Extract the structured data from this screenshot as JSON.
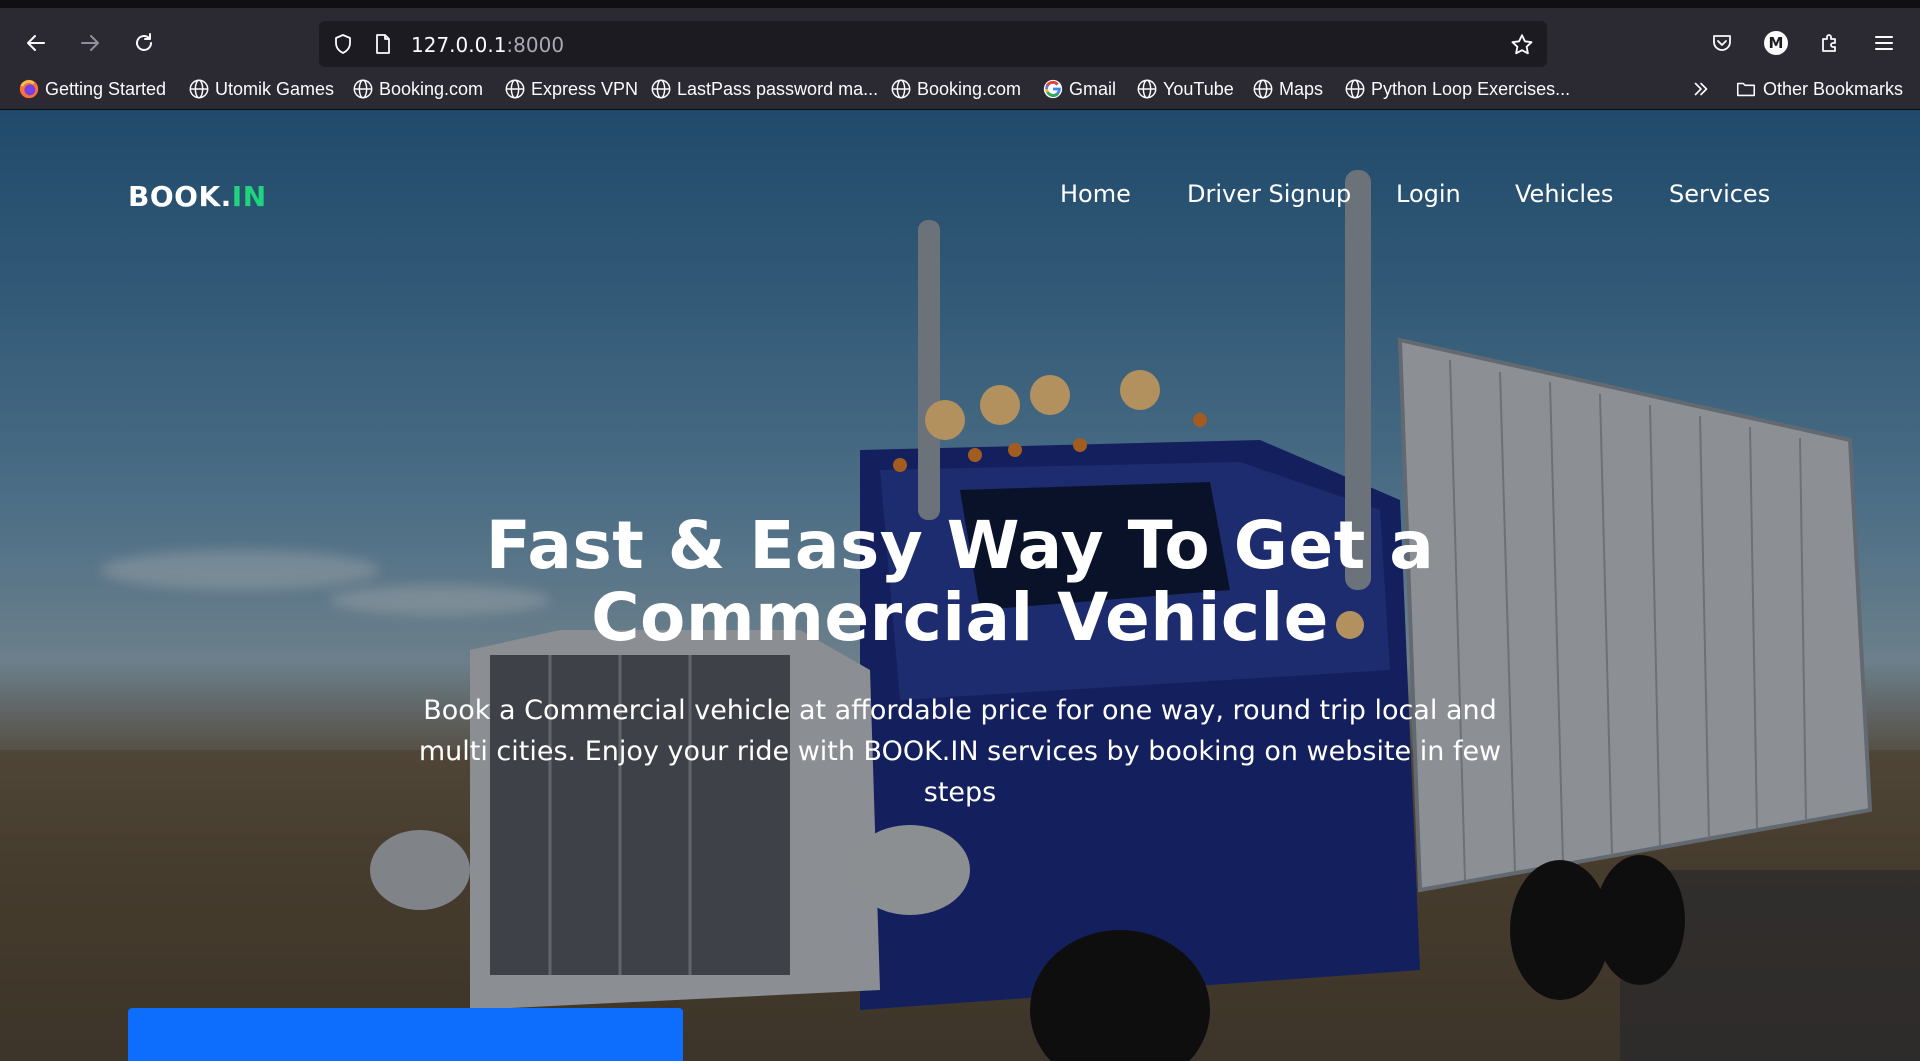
{
  "browser": {
    "url_host": "127.0.0.1",
    "url_port": ":8000",
    "profile_initial": "M",
    "icons": {
      "back": "arrow-left-icon",
      "forward": "arrow-right-icon",
      "reload": "reload-icon",
      "shield": "shield-icon",
      "page": "page-icon",
      "star": "star-icon",
      "pocket": "pocket-icon",
      "extensions": "puzzle-icon",
      "menu": "hamburger-icon"
    }
  },
  "bookmarks": {
    "items": [
      {
        "label": "Getting Started",
        "icon": "firefox-icon"
      },
      {
        "label": "Utomik Games",
        "icon": "globe-icon"
      },
      {
        "label": "Booking.com",
        "icon": "globe-icon"
      },
      {
        "label": "Express VPN",
        "icon": "globe-icon"
      },
      {
        "label": "LastPass password ma...",
        "icon": "globe-icon"
      },
      {
        "label": "Booking.com",
        "icon": "globe-icon"
      },
      {
        "label": "Gmail",
        "icon": "google-icon"
      },
      {
        "label": "YouTube",
        "icon": "globe-icon"
      },
      {
        "label": "Maps",
        "icon": "globe-icon"
      },
      {
        "label": "Python Loop Exercises...",
        "icon": "globe-icon"
      }
    ],
    "other_label": "Other Bookmarks"
  },
  "site": {
    "logo_main": "BOOK.",
    "logo_accent": "IN",
    "nav": [
      "Home",
      "Driver Signup",
      "Login",
      "Vehicles",
      "Services"
    ],
    "headline_line1": "Fast & Easy Way To Get a",
    "headline_line2": "Commercial Vehicle",
    "subtext": "Book a Commercial vehicle at affordable price for one way, round trip local and multi cities. Enjoy your ride with BOOK.IN services by booking on website in few steps",
    "colors": {
      "accent": "#1fd47c",
      "cta": "#0d6efd"
    }
  }
}
